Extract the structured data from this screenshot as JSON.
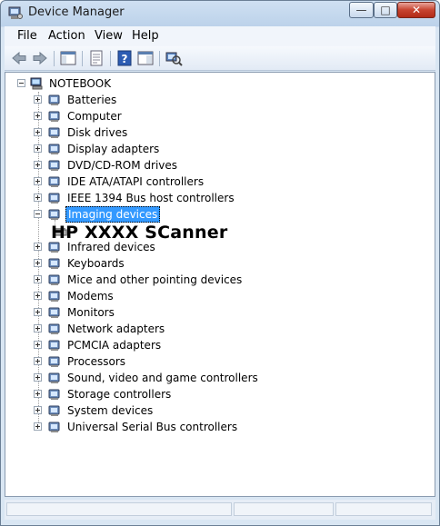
{
  "window": {
    "title": "Device Manager"
  },
  "menus": [
    "File",
    "Action",
    "View",
    "Help"
  ],
  "toolbar": [
    "back-icon",
    "forward-icon",
    "show-hide-tree-icon",
    "properties-icon",
    "help-icon",
    "console-view-icon",
    "scan-hardware-icon"
  ],
  "tree": {
    "root": "NOTEBOOK",
    "categories": [
      {
        "label": "Batteries",
        "icon": "battery-icon",
        "expanded": false
      },
      {
        "label": "Computer",
        "icon": "computer-icon",
        "expanded": false
      },
      {
        "label": "Disk drives",
        "icon": "disk-drive-icon",
        "expanded": false
      },
      {
        "label": "Display adapters",
        "icon": "display-adapter-icon",
        "expanded": false
      },
      {
        "label": "DVD/CD-ROM drives",
        "icon": "dvd-drive-icon",
        "expanded": false
      },
      {
        "label": "IDE ATA/ATAPI controllers",
        "icon": "ide-controller-icon",
        "expanded": false
      },
      {
        "label": "IEEE 1394 Bus host controllers",
        "icon": "firewire-icon",
        "expanded": false
      },
      {
        "label": "Imaging devices",
        "icon": "scanner-icon",
        "expanded": true,
        "selected": true
      },
      {
        "label": "Infrared devices",
        "icon": "infrared-icon",
        "expanded": false
      },
      {
        "label": "Keyboards",
        "icon": "keyboard-icon",
        "expanded": false
      },
      {
        "label": "Mice and other pointing devices",
        "icon": "mouse-icon",
        "expanded": false
      },
      {
        "label": "Modems",
        "icon": "modem-icon",
        "expanded": false
      },
      {
        "label": "Monitors",
        "icon": "monitor-icon",
        "expanded": false
      },
      {
        "label": "Network adapters",
        "icon": "network-adapter-icon",
        "expanded": false
      },
      {
        "label": "PCMCIA adapters",
        "icon": "pcmcia-icon",
        "expanded": false
      },
      {
        "label": "Processors",
        "icon": "processor-icon",
        "expanded": false
      },
      {
        "label": "Sound, video and game controllers",
        "icon": "speaker-icon",
        "expanded": false
      },
      {
        "label": "Storage controllers",
        "icon": "storage-controller-icon",
        "expanded": false
      },
      {
        "label": "System devices",
        "icon": "system-devices-icon",
        "expanded": false
      },
      {
        "label": "Universal Serial Bus controllers",
        "icon": "usb-icon",
        "expanded": false
      }
    ],
    "imaging_child": {
      "label": "HP XXXX SCanner",
      "icon": "scanner-device-icon"
    }
  },
  "colors": {
    "selection": "#3399ff",
    "close_button": "#c7432f"
  }
}
